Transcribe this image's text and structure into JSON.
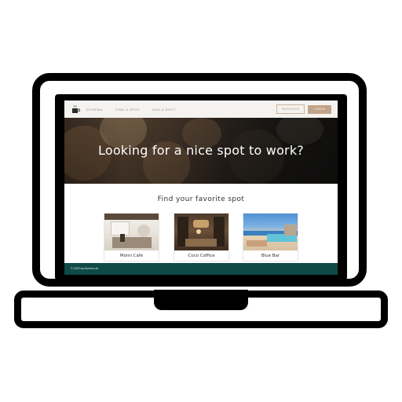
{
  "navbar": {
    "logo_icon": "cup-icon",
    "links": [
      "DOXEMA",
      "FIND A SPOT",
      "ADD A SPOT"
    ],
    "register_label": "REGISTER",
    "login_label": "LOGIN"
  },
  "hero": {
    "title": "Looking for a nice spot to work?"
  },
  "spots": {
    "title": "Find your favorite spot",
    "cards": [
      {
        "name": "Momi Café"
      },
      {
        "name": "Coco Coffice"
      },
      {
        "name": "Blue Bar"
      }
    ]
  },
  "footer": {
    "text": "© 2022 by doxema ab"
  },
  "colors": {
    "footer": "#0f4a47",
    "accent": "#c2a389",
    "navbar": "#f5f3ef"
  }
}
